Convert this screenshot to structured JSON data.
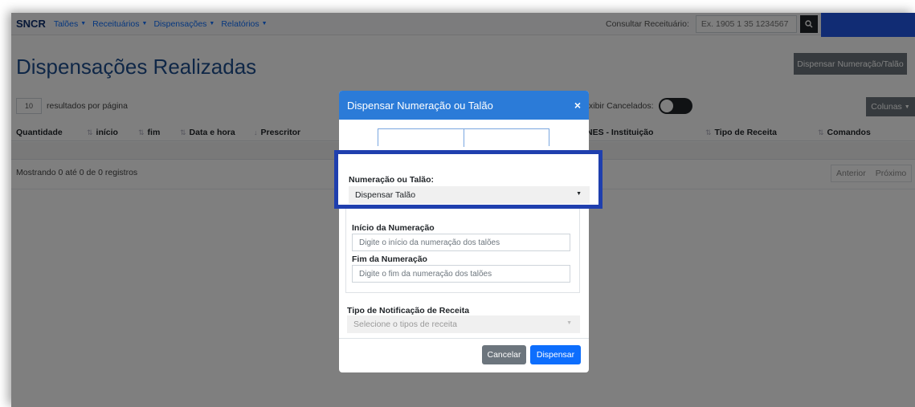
{
  "navbar": {
    "brand": "SNCR",
    "items": [
      {
        "label": "Talões"
      },
      {
        "label": "Receituários"
      },
      {
        "label": "Dispensações"
      },
      {
        "label": "Relatórios"
      }
    ],
    "consult_label": "Consultar Receituário:",
    "consult_placeholder": "Ex. 1905 1 35 1234567",
    "search_icon": "search-icon"
  },
  "page": {
    "title": "Dispensações Realizadas",
    "top_button": "Dispensar Numeração/Talão",
    "per_page_value": "10",
    "per_page_label": "resultados por página",
    "exibir_label": "Exibir Cancelados:",
    "colunas_button": "Colunas",
    "columns": [
      "Quantidade",
      "início",
      "fim",
      "Data e hora",
      "Prescritor",
      "NES - Instituição",
      "Tipo de Receita",
      "Comandos"
    ],
    "info": "Mostrando 0 até 0 de 0 registros",
    "pager": {
      "prev": "Anterior",
      "next": "Próximo"
    }
  },
  "modal": {
    "title": "Dispensar Numeração ou Talão",
    "close": "×",
    "numeracao_label": "Numeração ou Talão:",
    "numeracao_value": "Dispensar Talão",
    "inicio_label": "Início da Numeração",
    "inicio_placeholder": "Digite o início da numeração dos talões",
    "fim_label": "Fim da Numeração",
    "fim_placeholder": "Digite o fim da numeração dos talões",
    "tipo_label": "Tipo de Notificação de Receita",
    "tipo_placeholder": "Selecione o tipos de receita",
    "cancel": "Cancelar",
    "submit": "Dispensar"
  },
  "colors": {
    "highlight": "#1f3fae",
    "modal_header": "#2b7bd8",
    "primary": "#0d6efd",
    "corner_box": "#2358e8"
  }
}
